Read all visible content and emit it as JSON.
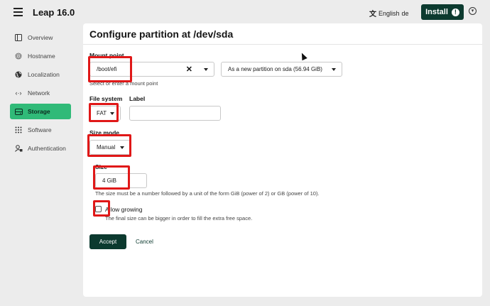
{
  "header": {
    "app_title": "Leap 16.0",
    "language": "English",
    "language_code": "de",
    "install_label": "Install",
    "menu_icon": "hamburger-icon",
    "warning_icon": "exclamation-icon",
    "options_icon": "chevron-down-circle-icon"
  },
  "sidebar": {
    "items": [
      {
        "label": "Overview",
        "icon": "layout-icon",
        "active": false
      },
      {
        "label": "Hostname",
        "icon": "fingerprint-icon",
        "active": false
      },
      {
        "label": "Localization",
        "icon": "globe-icon",
        "active": false
      },
      {
        "label": "Network",
        "icon": "network-icon",
        "active": false
      },
      {
        "label": "Storage",
        "icon": "hard-drive-icon",
        "active": true
      },
      {
        "label": "Software",
        "icon": "grid-icon",
        "active": false
      },
      {
        "label": "Authentication",
        "icon": "user-lock-icon",
        "active": false
      }
    ]
  },
  "form": {
    "title": "Configure partition at /dev/sda",
    "mount_point": {
      "label": "Mount point",
      "value": "/boot/efi",
      "help": "Select or enter a mount point",
      "target": "As a new partition on sda (56.94 GiB)"
    },
    "file_system": {
      "label": "File system",
      "value": "FAT"
    },
    "fs_label": {
      "label": "Label",
      "value": ""
    },
    "size_mode": {
      "label": "Size mode",
      "value": "Manual"
    },
    "size": {
      "label": "Size",
      "value": "4 GiB",
      "help": "The size must be a number followed by a unit of the form GiB (power of 2) or GB (power of 10)."
    },
    "allow_growing": {
      "label": "Allow growing",
      "checked": false,
      "help": "The final size can be bigger in order to fill the extra free space."
    },
    "accept_label": "Accept",
    "cancel_label": "Cancel"
  },
  "colors": {
    "accent_dark": "#0c3a2f",
    "active_green": "#30ba78",
    "highlight_red": "#e01818"
  }
}
